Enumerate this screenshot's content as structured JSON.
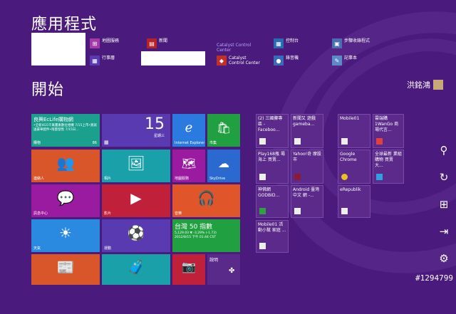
{
  "headings": {
    "apps": "應用程式",
    "start": "開始"
  },
  "apps": [
    {
      "label": "地圖服務",
      "icon": "map-icon",
      "color": "#a33aa8"
    },
    {
      "label": "新聞",
      "icon": "news-icon",
      "color": "#b5222a"
    },
    {
      "label": "Catalyst Control Center",
      "icon": "",
      "color": ""
    },
    {
      "label": "控制台",
      "icon": "control-panel-icon",
      "color": "#2a6ab0"
    },
    {
      "label": "步驟收錄程式",
      "icon": "steps-recorder-icon",
      "color": "#4a6fb0"
    },
    {
      "label": "行事曆",
      "icon": "calendar-icon",
      "color": "#5a3ab0"
    },
    {
      "label": "Catalyst Control Center",
      "icon": "catalyst-icon",
      "color": "#c0302a"
    },
    {
      "label": "錄音機",
      "icon": "sound-recorder-icon",
      "color": "#3a6ab8"
    },
    {
      "label": "記事本",
      "icon": "notepad-icon",
      "color": "#5a8ac8"
    }
  ],
  "user": {
    "name": "洪銘鴻"
  },
  "tiles": {
    "store_promo": {
      "title": "良興EcLife購物網",
      "body": "•全新4G5千萬畫素數位相機 7/15上市•買就送豪華配件•限量發售 7/15日…",
      "label": "購物",
      "badge": "86"
    },
    "calendar": {
      "day": "15",
      "weekday": "星期三"
    },
    "ie": {
      "label": "Internet Explorer"
    },
    "store": {
      "label": "市集"
    },
    "contacts": {
      "label": "連絡人"
    },
    "photos": {
      "label": "相片"
    },
    "maps": {
      "label": "地圖服務"
    },
    "skydrive": {
      "label": "SkyDrive"
    },
    "messaging": {
      "label": "訊息中心"
    },
    "video": {
      "label": "影片"
    },
    "music": {
      "label": "音樂"
    },
    "weather": {
      "label": "天氣"
    },
    "sports": {
      "label": "運動"
    },
    "finance": {
      "title": "台灣 50 指數",
      "line1": "5,129.03 ▼ -3.29% (-1.73)",
      "line2": "2012/8/15 下午 01:44 CST"
    },
    "news": {
      "label": ""
    },
    "travel": {
      "label": ""
    },
    "camera": {
      "label": ""
    },
    "help": {
      "label": "說明"
    }
  },
  "desktop_tiles": [
    {
      "text": "(2) 三國擲專區 - Faceboo...",
      "icon": "ie-icon"
    },
    {
      "text": "新聞又 遊戲 gameba...",
      "icon": "ie-icon"
    },
    {
      "text": "Mobile01",
      "icon": "mobile01-icon"
    },
    {
      "text": "雲端購 1WanGo 商場代言...",
      "icon": "wango-icon"
    },
    {
      "text": "Play168瓶 場海上 買賣...",
      "icon": "ie-icon"
    },
    {
      "text": "Yahoo!奇 摩股市",
      "icon": "yahoo-icon"
    },
    {
      "text": "Google Chrome",
      "icon": "chrome-icon"
    },
    {
      "text": "全球最新 業組購物 買賣 大...",
      "icon": "tool-icon"
    },
    {
      "text": "神佛網 GODBID...",
      "icon": "ie-icon"
    },
    {
      "text": "Android 臺灣中文 網 -...",
      "icon": "android-icon"
    },
    {
      "text": "eRepublik",
      "icon": "erepublik-icon"
    },
    {
      "text": "Mobile01 活動小幫 家庭 ...",
      "icon": "mobile01-icon"
    }
  ],
  "watermark": "#1294799"
}
